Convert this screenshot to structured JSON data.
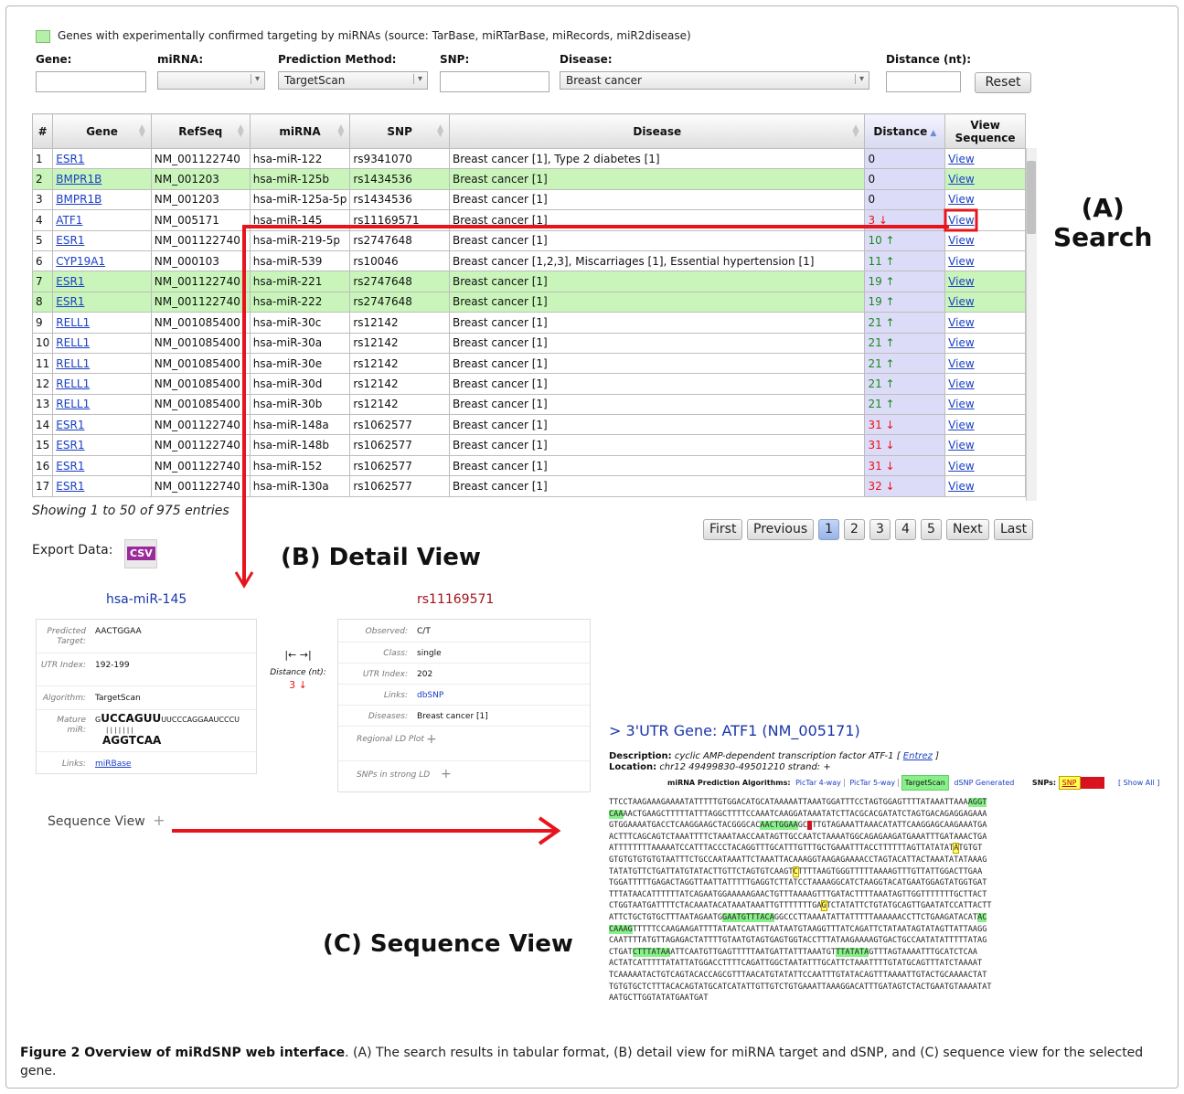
{
  "legend": {
    "text": "Genes with experimentally confirmed targeting by miRNAs (source: TarBase, miRTarBase, miRecords, miR2disease)",
    "color": "#b6f0a8"
  },
  "filters": {
    "gene_label": "Gene:",
    "mirna_label": "miRNA:",
    "method_label": "Prediction Method:",
    "method_value": "TargetScan",
    "snp_label": "SNP:",
    "disease_label": "Disease:",
    "disease_value": "Breast cancer",
    "distance_label": "Distance (nt):",
    "reset_label": "Reset"
  },
  "table": {
    "columns": [
      "#",
      "Gene",
      "RefSeq",
      "miRNA",
      "SNP",
      "Disease",
      "Distance",
      "View Sequence"
    ],
    "view_label": "View",
    "rows": [
      {
        "n": "1",
        "gene": "ESR1",
        "refseq": "NM_001122740",
        "mirna": "hsa-miR-122",
        "snp": "rs9341070",
        "disease": "Breast cancer [1], Type 2 diabetes [1]",
        "distance": "0",
        "dir": "",
        "green": false
      },
      {
        "n": "2",
        "gene": "BMPR1B",
        "refseq": "NM_001203",
        "mirna": "hsa-miR-125b",
        "snp": "rs1434536",
        "disease": "Breast cancer [1]",
        "distance": "0",
        "dir": "",
        "green": true
      },
      {
        "n": "3",
        "gene": "BMPR1B",
        "refseq": "NM_001203",
        "mirna": "hsa-miR-125a-5p",
        "snp": "rs1434536",
        "disease": "Breast cancer [1]",
        "distance": "0",
        "dir": "",
        "green": false
      },
      {
        "n": "4",
        "gene": "ATF1",
        "refseq": "NM_005171",
        "mirna": "hsa-miR-145",
        "snp": "rs11169571",
        "disease": "Breast cancer [1]",
        "distance": "3 ↓",
        "dir": "down",
        "green": false
      },
      {
        "n": "5",
        "gene": "ESR1",
        "refseq": "NM_001122740",
        "mirna": "hsa-miR-219-5p",
        "snp": "rs2747648",
        "disease": "Breast cancer [1]",
        "distance": "10 ↑",
        "dir": "up",
        "green": false
      },
      {
        "n": "6",
        "gene": "CYP19A1",
        "refseq": "NM_000103",
        "mirna": "hsa-miR-539",
        "snp": "rs10046",
        "disease": "Breast cancer [1,2,3], Miscarriages [1], Essential hypertension [1]",
        "distance": "11 ↑",
        "dir": "up",
        "green": false
      },
      {
        "n": "7",
        "gene": "ESR1",
        "refseq": "NM_001122740",
        "mirna": "hsa-miR-221",
        "snp": "rs2747648",
        "disease": "Breast cancer [1]",
        "distance": "19 ↑",
        "dir": "up",
        "green": true
      },
      {
        "n": "8",
        "gene": "ESR1",
        "refseq": "NM_001122740",
        "mirna": "hsa-miR-222",
        "snp": "rs2747648",
        "disease": "Breast cancer [1]",
        "distance": "19 ↑",
        "dir": "up",
        "green": true
      },
      {
        "n": "9",
        "gene": "RELL1",
        "refseq": "NM_001085400",
        "mirna": "hsa-miR-30c",
        "snp": "rs12142",
        "disease": "Breast cancer [1]",
        "distance": "21 ↑",
        "dir": "up",
        "green": false
      },
      {
        "n": "10",
        "gene": "RELL1",
        "refseq": "NM_001085400",
        "mirna": "hsa-miR-30a",
        "snp": "rs12142",
        "disease": "Breast cancer [1]",
        "distance": "21 ↑",
        "dir": "up",
        "green": false
      },
      {
        "n": "11",
        "gene": "RELL1",
        "refseq": "NM_001085400",
        "mirna": "hsa-miR-30e",
        "snp": "rs12142",
        "disease": "Breast cancer [1]",
        "distance": "21 ↑",
        "dir": "up",
        "green": false
      },
      {
        "n": "12",
        "gene": "RELL1",
        "refseq": "NM_001085400",
        "mirna": "hsa-miR-30d",
        "snp": "rs12142",
        "disease": "Breast cancer [1]",
        "distance": "21 ↑",
        "dir": "up",
        "green": false
      },
      {
        "n": "13",
        "gene": "RELL1",
        "refseq": "NM_001085400",
        "mirna": "hsa-miR-30b",
        "snp": "rs12142",
        "disease": "Breast cancer [1]",
        "distance": "21 ↑",
        "dir": "up",
        "green": false
      },
      {
        "n": "14",
        "gene": "ESR1",
        "refseq": "NM_001122740",
        "mirna": "hsa-miR-148a",
        "snp": "rs1062577",
        "disease": "Breast cancer [1]",
        "distance": "31 ↓",
        "dir": "down",
        "green": false
      },
      {
        "n": "15",
        "gene": "ESR1",
        "refseq": "NM_001122740",
        "mirna": "hsa-miR-148b",
        "snp": "rs1062577",
        "disease": "Breast cancer [1]",
        "distance": "31 ↓",
        "dir": "down",
        "green": false
      },
      {
        "n": "16",
        "gene": "ESR1",
        "refseq": "NM_001122740",
        "mirna": "hsa-miR-152",
        "snp": "rs1062577",
        "disease": "Breast cancer [1]",
        "distance": "31 ↓",
        "dir": "down",
        "green": false
      },
      {
        "n": "17",
        "gene": "ESR1",
        "refseq": "NM_001122740",
        "mirna": "hsa-miR-130a",
        "snp": "rs1062577",
        "disease": "Breast cancer [1]",
        "distance": "32 ↓",
        "dir": "down",
        "green": false
      }
    ]
  },
  "info": "Showing 1 to 50 of 975 entries",
  "pagination": {
    "first": "First",
    "previous": "Previous",
    "pages": [
      "1",
      "2",
      "3",
      "4",
      "5"
    ],
    "next": "Next",
    "last": "Last",
    "active": "1"
  },
  "export": {
    "label": "Export Data:",
    "csv": "CSV"
  },
  "labels": {
    "search": "(A)\nSearch",
    "detail": "(B) Detail View",
    "sequence": "(C) Sequence View"
  },
  "detail": {
    "mirna_title": "hsa-miR-145",
    "snp_title": "rs11169571",
    "predicted_target_key": "Predicted Target:",
    "predicted_target_val": "AACTGGAA",
    "utr_index_key": "UTR Index:",
    "utr_index_val": "192-199",
    "algorithm_key": "Algorithm:",
    "algorithm_val": "TargetScan",
    "mature_key": "Mature miR:",
    "mature_top_bold": "UCCAGUU",
    "mature_top_prefix": "G",
    "mature_top_rest": "UUCCCAGGAAUCCCU",
    "mature_pipes": "| | | | | | |",
    "mature_bottom": "AGGTCAA",
    "links_key": "Links:",
    "links_val": "miRBase",
    "arrow_symbol": "|←  →|",
    "distance_label": "Distance (nt):",
    "distance_val": "3 ↓",
    "observed_key": "Observed:",
    "observed_val": "C/T",
    "class_key": "Class:",
    "class_val": "single",
    "snp_utr_key": "UTR Index:",
    "snp_utr_val": "202",
    "snp_links_key": "Links:",
    "snp_links_val": "dbSNP",
    "diseases_key": "Diseases:",
    "diseases_val": "Breast cancer [1]",
    "regional_ld": "Regional LD Plot",
    "snps_strong_ld": "SNPs in strong LD",
    "sequence_view": "Sequence View"
  },
  "sequence": {
    "title": "> 3'UTR Gene: ATF1 (NM_005171)",
    "desc_label": "Description:",
    "desc_text": "cyclic AMP-dependent transcription factor ATF-1 [",
    "desc_link": "Entrez",
    "desc_end": "]",
    "loc_label": "Location:",
    "loc_text": "chr12 49499830-49501210   strand: +",
    "alg_label": "miRNA Prediction Algorithms:",
    "alg_items": [
      "PicTar 4-way",
      "PicTar 5-way",
      "TargetScan",
      "dSNP Generated"
    ],
    "snps_label": "SNPs:",
    "snp_btn": "SNP",
    "dsnp_btn": "dSNP",
    "show_all": "[ Show All ]",
    "highlight_color": "#88f088",
    "snp_color": "#ffff55",
    "dsnp_color": "#d3121f"
  },
  "caption": {
    "bold": "Figure 2 Overview of miRdSNP web interface",
    "text": ". (A) The search results in tabular format, (B) detail view for miRNA target and dSNP, and (C) sequence view for the selected gene."
  }
}
